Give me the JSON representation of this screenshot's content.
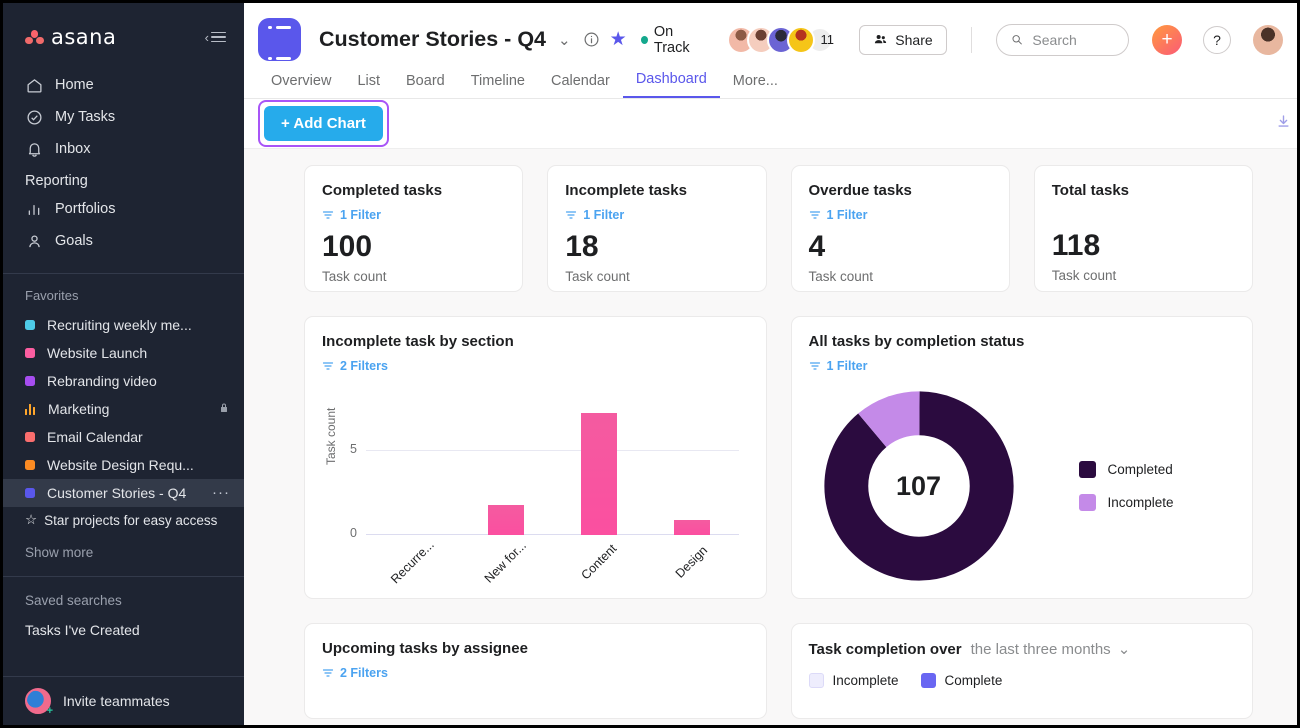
{
  "sidebar": {
    "brand": "asana",
    "collapse_label": "Collapse sidebar",
    "nav": [
      {
        "label": "Home",
        "icon": "home-icon"
      },
      {
        "label": "My Tasks",
        "icon": "check-circle-icon"
      },
      {
        "label": "Inbox",
        "icon": "bell-icon"
      }
    ],
    "reporting_header": "Reporting",
    "reporting": [
      {
        "label": "Portfolios",
        "icon": "bar-chart-icon"
      },
      {
        "label": "Goals",
        "icon": "goal-icon"
      }
    ],
    "favorites_header": "Favorites",
    "favorites": [
      {
        "label": "Recruiting weekly me...",
        "color": "#4ecbe8",
        "locked": false,
        "active": false
      },
      {
        "label": "Website Launch",
        "color": "#fc5ea1",
        "locked": false,
        "active": false
      },
      {
        "label": "Rebranding video",
        "color": "#a64df0",
        "locked": false,
        "active": false
      },
      {
        "label": "Marketing",
        "color": "#ffa62b",
        "locked": true,
        "active": false,
        "icon": "bar-chart-icon"
      },
      {
        "label": "Email Calendar",
        "color": "#fa6e6e",
        "locked": false,
        "active": false
      },
      {
        "label": "Website Design Requ...",
        "color": "#fb8b23",
        "locked": false,
        "active": false
      },
      {
        "label": "Customer Stories - Q4",
        "color": "#5a57eb",
        "locked": false,
        "active": true
      }
    ],
    "star_hint": "Star projects for easy access",
    "show_more": "Show more",
    "saved_searches_header": "Saved searches",
    "saved_searches": [
      {
        "label": "Tasks I've Created"
      }
    ],
    "invite": "Invite teammates"
  },
  "header": {
    "project_icon": "list-icon",
    "title": "Customer Stories - Q4",
    "dropdown_icon": "chevron-down-icon",
    "info_icon": "info-icon",
    "star_icon": "star-filled-icon",
    "status": "On Track",
    "status_color": "#14a88d",
    "member_count": "11",
    "share_label": "Share",
    "search_placeholder": "Search",
    "search_value": "",
    "plus_label": "+",
    "help_label": "?"
  },
  "tabs": [
    {
      "label": "Overview",
      "active": false
    },
    {
      "label": "List",
      "active": false
    },
    {
      "label": "Board",
      "active": false
    },
    {
      "label": "Timeline",
      "active": false
    },
    {
      "label": "Calendar",
      "active": false
    },
    {
      "label": "Dashboard",
      "active": true
    },
    {
      "label": "More...",
      "active": false
    }
  ],
  "toolbar": {
    "add_chart_label": "+ Add Chart",
    "add_chart_color": "#26abeb",
    "highlight_color": "#a855f7",
    "download_icon": "download-icon"
  },
  "metrics": [
    {
      "title": "Completed tasks",
      "filter": "1 Filter",
      "value": "100",
      "sub": "Task count"
    },
    {
      "title": "Incomplete tasks",
      "filter": "1 Filter",
      "value": "18",
      "sub": "Task count"
    },
    {
      "title": "Overdue tasks",
      "filter": "1 Filter",
      "value": "4",
      "sub": "Task count"
    },
    {
      "title": "Total tasks",
      "filter": "",
      "value": "118",
      "sub": "Task count"
    }
  ],
  "cards": {
    "bar": {
      "title": "Incomplete task by section",
      "filter": "2 Filters"
    },
    "donut": {
      "title": "All tasks by completion status",
      "filter": "1 Filter",
      "center": "107"
    },
    "upcoming": {
      "title": "Upcoming tasks by assignee",
      "filter": "2 Filters"
    },
    "completion": {
      "title": "Task completion over",
      "range": "the last three months",
      "range_icon": "chevron-down-icon",
      "legend": [
        {
          "label": "Incomplete",
          "color": "#eeedfd"
        },
        {
          "label": "Complete",
          "color": "#6966f2"
        }
      ]
    }
  },
  "chart_data": [
    {
      "type": "bar",
      "title": "Incomplete task by section",
      "categories": [
        "Recurre...",
        "New for...",
        "Content",
        "Design"
      ],
      "values": [
        0,
        2,
        8,
        1
      ],
      "xlabel": "",
      "ylabel": "Task count",
      "ylim": [
        0,
        9
      ],
      "yticks": [
        0,
        5
      ],
      "grid": true,
      "bar_color": "#fb4fa0",
      "legend": "none"
    },
    {
      "type": "pie",
      "title": "All tasks by completion status",
      "center_label": "107",
      "labels": [
        "Completed",
        "Incomplete"
      ],
      "values": [
        95,
        12
      ],
      "colors": [
        "#2b0b3f",
        "#c48ae8"
      ],
      "donut": true,
      "legend": "right"
    }
  ]
}
